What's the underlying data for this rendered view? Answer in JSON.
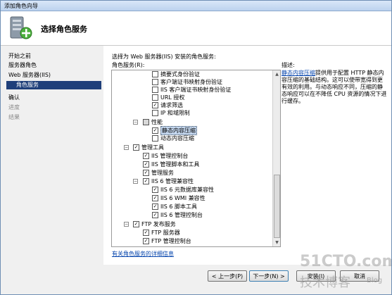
{
  "window": {
    "title": "添加角色向导"
  },
  "header": {
    "title": "选择角色服务"
  },
  "nav": {
    "items": [
      {
        "label": "开始之前",
        "state": "normal"
      },
      {
        "label": "服务器角色",
        "state": "normal"
      },
      {
        "label": "Web 服务器(IIS)",
        "state": "normal"
      },
      {
        "label": "角色服务",
        "state": "selected"
      },
      {
        "label": "确认",
        "state": "normal"
      },
      {
        "label": "进度",
        "state": "disabled"
      },
      {
        "label": "结果",
        "state": "disabled"
      }
    ]
  },
  "main": {
    "prompt": "选择为 Web 服务器(IIS) 安装的角色服务:",
    "services_label": "角色服务(R):",
    "tree": [
      {
        "label": "摘要式身份验证",
        "checked": false
      },
      {
        "label": "客户端证书映射身份验证",
        "checked": false
      },
      {
        "label": "IIS 客户端证书映射身份验证",
        "checked": false
      },
      {
        "label": "URL 授权",
        "checked": false
      },
      {
        "label": "请求筛选",
        "checked": true
      },
      {
        "label": "IP 和域限制",
        "checked": false
      },
      {
        "label": "性能",
        "checked": "partial",
        "expander": "−"
      },
      {
        "label": "静态内容压缩",
        "checked": true
      },
      {
        "label": "动态内容压缩",
        "checked": false
      },
      {
        "label": "管理工具",
        "checked": true,
        "expander": "−"
      },
      {
        "label": "IIS 管理控制台",
        "checked": true
      },
      {
        "label": "IIS 管理脚本和工具",
        "checked": true
      },
      {
        "label": "管理服务",
        "checked": true
      },
      {
        "label": "IIS 6 管理兼容性",
        "checked": true,
        "expander": "−"
      },
      {
        "label": "IIS 6 元数据库兼容性",
        "checked": true
      },
      {
        "label": "IIS 6 WMI 兼容性",
        "checked": true
      },
      {
        "label": "IIS 6 脚本工具",
        "checked": true
      },
      {
        "label": "IIS 6 管理控制台",
        "checked": true
      },
      {
        "label": "FTP 发布服务",
        "checked": true,
        "expander": "−"
      },
      {
        "label": "FTP 服务器",
        "checked": true
      },
      {
        "label": "FTP 管理控制台",
        "checked": true
      }
    ],
    "more_link": "有关角色服务的详细信息",
    "description": {
      "heading": "描述:",
      "link": "静态内容压缩",
      "text": "提供用于配置 HTTP 静态内容压缩的基础结构。这可以使带宽得到更有效的利用。与动态响应不同，压缩的静态响应可以在不降低 CPU 资源的情况下进行缓存。"
    }
  },
  "footer": {
    "prev": "< 上一步(P)",
    "next": "下一步(N) >",
    "install": "安装(I)",
    "cancel": "取消"
  },
  "watermark": {
    "line1": "51CTO.com",
    "line2": "技术博客",
    "line3": "Blog"
  },
  "colors": {
    "selection": "#1f3f7a",
    "link": "#0645ad",
    "highlight": "#c5d8f0"
  },
  "icons": {
    "wizard": "server-add-icon",
    "check": "✓",
    "expander": "−"
  }
}
